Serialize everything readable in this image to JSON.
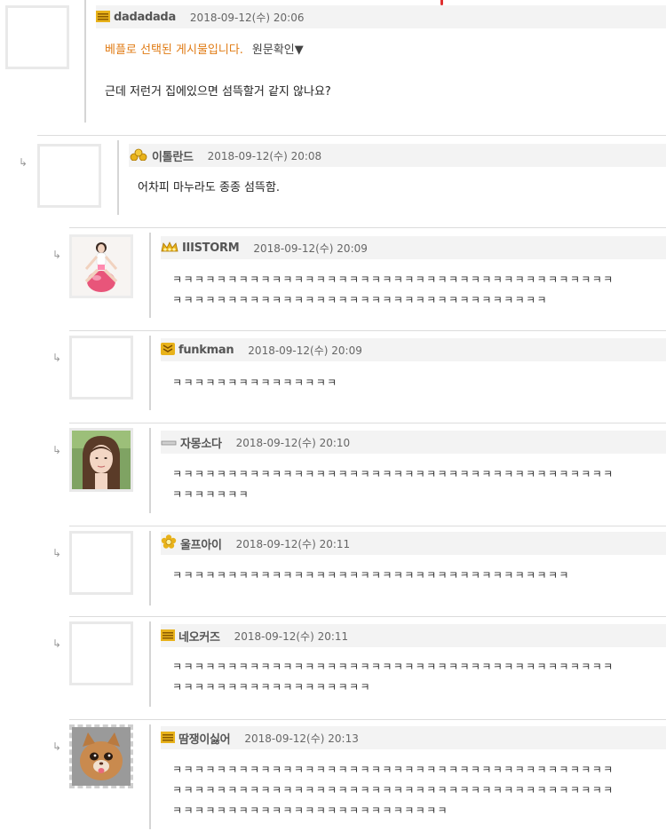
{
  "comments": [
    {
      "nick": "dadadada",
      "date": "2018-09-12(수) 20:06",
      "notice": "베플로 선택된 게시물입니다.",
      "view_original": "원문확인▼",
      "text": "근데 저런거 집에있으면 섬뜩할거 같지 않나요?",
      "badge_icon": "level-bars-icon"
    },
    {
      "nick": "이톨란드",
      "date": "2018-09-12(수) 20:08",
      "text": "어차피 마누라도 종종 섬뜩함.",
      "badge_icon": "gold-pile-icon"
    },
    {
      "nick": "IIISTORM",
      "date": "2018-09-12(수) 20:09",
      "lines": [
        "ㅋㅋㅋㅋㅋㅋㅋㅋㅋㅋㅋㅋㅋㅋㅋㅋㅋㅋㅋㅋㅋㅋㅋㅋㅋㅋㅋㅋㅋㅋㅋㅋㅋㅋㅋㅋㅋㅋㅋㅋ",
        "ㅋㅋㅋㅋㅋㅋㅋㅋㅋㅋㅋㅋㅋㅋㅋㅋㅋㅋㅋㅋㅋㅋㅋㅋㅋㅋㅋㅋㅋㅋㅋㅋㅋㅋ"
      ],
      "badge_icon": "gold-crown-icon"
    },
    {
      "nick": "funkman",
      "date": "2018-09-12(수) 20:09",
      "lines": [
        "ㅋㅋㅋㅋㅋㅋㅋㅋㅋㅋㅋㅋㅋㅋㅋ"
      ],
      "badge_icon": "gold-chevron-icon"
    },
    {
      "nick": "자몽소다",
      "date": "2018-09-12(수) 20:10",
      "lines": [
        "ㅋㅋㅋㅋㅋㅋㅋㅋㅋㅋㅋㅋㅋㅋㅋㅋㅋㅋㅋㅋㅋㅋㅋㅋㅋㅋㅋㅋㅋㅋㅋㅋㅋㅋㅋㅋㅋㅋㅋㅋ",
        "ㅋㅋㅋㅋㅋㅋㅋ"
      ],
      "badge_icon": "single-bar-icon"
    },
    {
      "nick": "울프아이",
      "date": "2018-09-12(수) 20:11",
      "lines": [
        "ㅋㅋㅋㅋㅋㅋㅋㅋㅋㅋㅋㅋㅋㅋㅋㅋㅋㅋㅋㅋㅋㅋㅋㅋㅋㅋㅋㅋㅋㅋㅋㅋㅋㅋㅋㅋ"
      ],
      "badge_icon": "gold-flower-icon"
    },
    {
      "nick": "네오커즈",
      "date": "2018-09-12(수) 20:11",
      "lines": [
        "ㅋㅋㅋㅋㅋㅋㅋㅋㅋㅋㅋㅋㅋㅋㅋㅋㅋㅋㅋㅋㅋㅋㅋㅋㅋㅋㅋㅋㅋㅋㅋㅋㅋㅋㅋㅋㅋㅋㅋㅋ",
        "ㅋㅋㅋㅋㅋㅋㅋㅋㅋㅋㅋㅋㅋㅋㅋㅋㅋㅋ"
      ],
      "badge_icon": "level-bars-icon"
    },
    {
      "nick": "땀쟁이싫어",
      "date": "2018-09-12(수) 20:13",
      "lines": [
        "ㅋㅋㅋㅋㅋㅋㅋㅋㅋㅋㅋㅋㅋㅋㅋㅋㅋㅋㅋㅋㅋㅋㅋㅋㅋㅋㅋㅋㅋㅋㅋㅋㅋㅋㅋㅋㅋㅋㅋㅋ",
        "ㅋㅋㅋㅋㅋㅋㅋㅋㅋㅋㅋㅋㅋㅋㅋㅋㅋㅋㅋㅋㅋㅋㅋㅋㅋㅋㅋㅋㅋㅋㅋㅋㅋㅋㅋㅋㅋㅋㅋㅋ",
        "ㅋㅋㅋㅋㅋㅋㅋㅋㅋㅋㅋㅋㅋㅋㅋㅋㅋㅋㅋㅋㅋㅋㅋㅋㅋ"
      ],
      "badge_icon": "level-bars-icon"
    }
  ],
  "reply_arrow": "↳",
  "colors": {
    "header_bg": "#f3f3f3",
    "divider": "#dcdcdc",
    "notice": "#e07b14",
    "badge_gold": "#e8b21a"
  }
}
